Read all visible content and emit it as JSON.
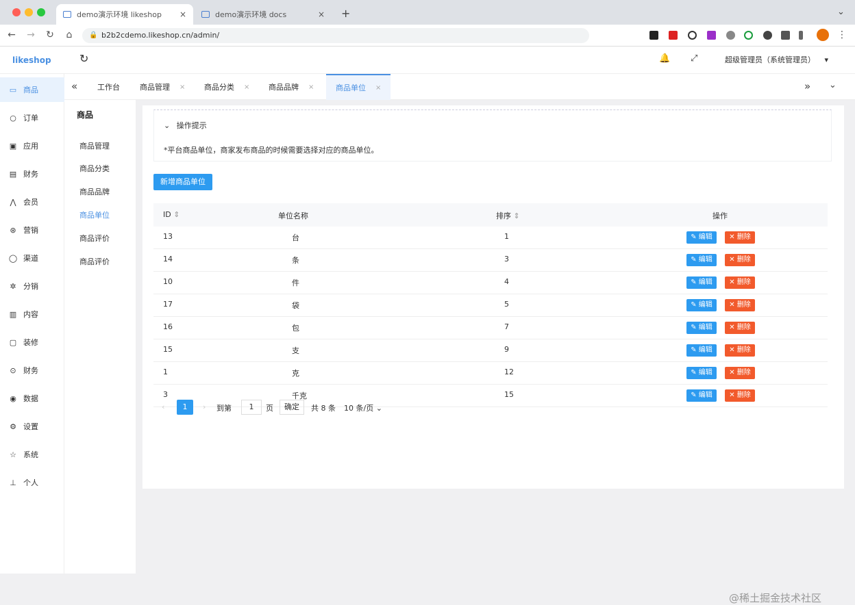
{
  "browser": {
    "tabs": [
      {
        "label": "demo演示环境 likeshop",
        "close": "×"
      },
      {
        "label": "demo演示环境 docs",
        "close": "×"
      }
    ],
    "new_tab": "+",
    "menu_chevron": "⌄",
    "url": "b2b2cdemo.likeshop.cn/admin/",
    "nav": {
      "back": "←",
      "forward": "→",
      "reload": "↻",
      "home": "⌂"
    }
  },
  "topbar": {
    "logo": "likeshop",
    "refresh": "↻",
    "bell": "🔔",
    "fullscreen": "⤢",
    "admin_label": "超级管理员（系统管理员）",
    "admin_chevron": "▾"
  },
  "sidebar": {
    "items": [
      {
        "icon": "▭",
        "label": "商品"
      },
      {
        "icon": "○",
        "label": "订单"
      },
      {
        "icon": "▣",
        "label": "应用"
      },
      {
        "icon": "▤",
        "label": "财务"
      },
      {
        "icon": "⋀",
        "label": "会员"
      },
      {
        "icon": "⊛",
        "label": "营销"
      },
      {
        "icon": "◯",
        "label": "渠道"
      },
      {
        "icon": "✲",
        "label": "分销"
      },
      {
        "icon": "▥",
        "label": "内容"
      },
      {
        "icon": "▢",
        "label": "装修"
      },
      {
        "icon": "⊙",
        "label": "财务"
      },
      {
        "icon": "◉",
        "label": "数据"
      },
      {
        "icon": "⚙",
        "label": "设置"
      },
      {
        "icon": "☆",
        "label": "系统"
      },
      {
        "icon": "⊥",
        "label": "个人"
      }
    ]
  },
  "tabsbar": {
    "collapse": "«",
    "expand_right": "»",
    "more": "⌄",
    "tabs": [
      {
        "label": "工作台",
        "close": ""
      },
      {
        "label": "商品管理",
        "close": "×"
      },
      {
        "label": "商品分类",
        "close": "×"
      },
      {
        "label": "商品品牌",
        "close": "×"
      },
      {
        "label": "商品单位",
        "close": "×"
      }
    ]
  },
  "submenu": {
    "title": "商品",
    "items": [
      "商品管理",
      "商品分类",
      "商品品牌",
      "商品单位",
      "商品评价",
      "商品评价"
    ]
  },
  "tips": {
    "toggle": "⌄",
    "title": "操作提示",
    "text": "*平台商品单位，商家发布商品的时候需要选择对应的商品单位。"
  },
  "add_button": "新增商品单位",
  "table": {
    "headers": {
      "id": "ID",
      "name": "单位名称",
      "sort": "排序",
      "action": "操作",
      "sort_icon": "⇕"
    },
    "edit_label": "✎ 编辑",
    "delete_label": "✕ 删除",
    "rows": [
      {
        "id": "13",
        "name": "台",
        "sort": "1"
      },
      {
        "id": "14",
        "name": "条",
        "sort": "3"
      },
      {
        "id": "10",
        "name": "件",
        "sort": "4"
      },
      {
        "id": "17",
        "name": "袋",
        "sort": "5"
      },
      {
        "id": "16",
        "name": "包",
        "sort": "7"
      },
      {
        "id": "15",
        "name": "支",
        "sort": "9"
      },
      {
        "id": "1",
        "name": "克",
        "sort": "12"
      },
      {
        "id": "3",
        "name": "千克",
        "sort": "15"
      }
    ]
  },
  "pager": {
    "prev": "‹",
    "current": "1",
    "next": "›",
    "goto": "到第",
    "page_input": "1",
    "page_unit": "页",
    "confirm": "确定",
    "total": "共 8 条",
    "page_size": "10 条/页 ⌄"
  },
  "watermark": "@稀土掘金技术社区"
}
